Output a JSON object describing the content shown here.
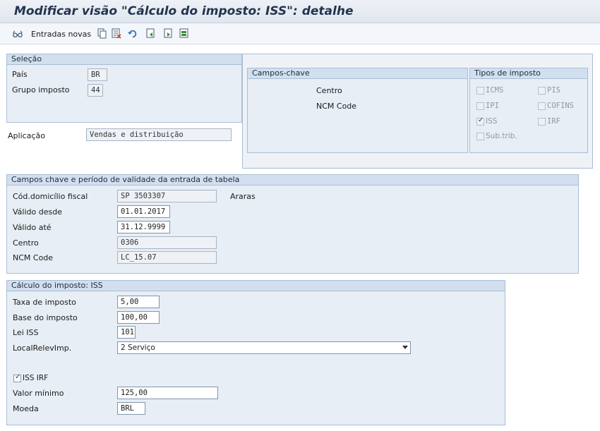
{
  "window": {
    "title": "Modificar visão \"Cálculo do imposto: ISS\": detalhe"
  },
  "toolbar": {
    "new_entries_label": "Entradas novas",
    "icons": [
      "glasses-icon",
      "copy-icon",
      "delete-icon",
      "undo-icon",
      "previous-entry-icon",
      "next-entry-icon",
      "select-block-icon"
    ]
  },
  "selection": {
    "header": "Seleção",
    "country_label": "País",
    "country_value": "BR",
    "tax_group_label": "Grupo imposto",
    "tax_group_value": "44"
  },
  "application": {
    "label": "Aplicação",
    "value": "Vendas e distribuição"
  },
  "key_fields": {
    "header": "Campos-chave",
    "items": [
      "Centro",
      "NCM Code"
    ]
  },
  "tax_types": {
    "header": "Tipos de imposto",
    "items": [
      {
        "label": "ICMS",
        "checked": false
      },
      {
        "label": "PIS",
        "checked": false
      },
      {
        "label": "IPI",
        "checked": false
      },
      {
        "label": "COFINS",
        "checked": false
      },
      {
        "label": "ISS",
        "checked": true
      },
      {
        "label": "IRF",
        "checked": false
      },
      {
        "label": "Sub.trib.",
        "checked": false
      }
    ]
  },
  "validity": {
    "header": "Campos chave e período de validade da entrada de tabela",
    "tax_domicile_label": "Cód.domicílio fiscal",
    "tax_domicile_value": "SP 3503307",
    "tax_domicile_desc": "Araras",
    "valid_from_label": "Válido desde",
    "valid_from_value": "01.01.2017",
    "valid_to_label": "Válido até",
    "valid_to_value": "31.12.9999",
    "plant_label": "Centro",
    "plant_value": "0306",
    "ncm_label": "NCM Code",
    "ncm_value": "LC_15.07"
  },
  "calc": {
    "header": "Cálculo do imposto: ISS",
    "rate_label": "Taxa de imposto",
    "rate_value": "5,00",
    "base_label": "Base do imposto",
    "base_value": "100,00",
    "law_label": "Lei ISS",
    "law_value": "101",
    "relevance_label": "LocalRelevImp.",
    "relevance_value": "2 Serviço",
    "iss_irf_label": "ISS IRF",
    "iss_irf_checked": true,
    "min_value_label": "Valor mínimo",
    "min_value_value": "125,00",
    "currency_label": "Moeda",
    "currency_value": "BRL"
  },
  "colors": {
    "panel_bg": "#e8eef5",
    "panel_header": "#d2dfee",
    "title_text": "#23344e"
  }
}
